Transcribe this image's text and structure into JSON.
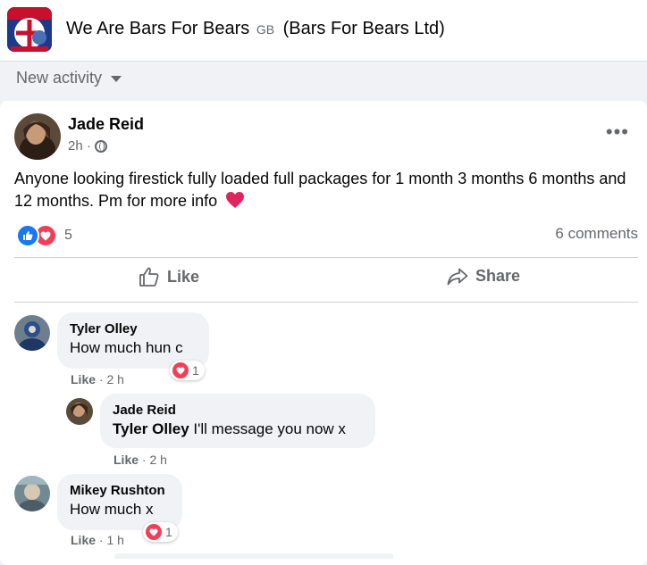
{
  "group": {
    "name": "We Are Bars For Bears",
    "country": "GB",
    "org": "(Bars For Bears Ltd)"
  },
  "sort": {
    "label": "New activity"
  },
  "post": {
    "author": "Jade Reid",
    "time": "2h ·",
    "text": "Anyone looking firestick fully loaded full packages for 1 month 3 months 6 months and 12 months. Pm for more info",
    "reaction_count": "5",
    "comments_count": "6 comments",
    "actions": {
      "like": "Like",
      "share": "Share"
    }
  },
  "comments": [
    {
      "name": "Tyler Olley",
      "text": "How much hun c",
      "like": "Like",
      "time": "· 2 h",
      "reactions": "1"
    },
    {
      "name": "Jade Reid",
      "mention": "Tyler Olley",
      "text": "I'll message you now x",
      "like": "Like",
      "time": "· 2 h"
    },
    {
      "name": "Mikey Rushton",
      "text": "How much x",
      "like": "Like",
      "time": "· 1 h",
      "reactions": "1"
    }
  ],
  "colors": {
    "like_blue": "#1877f2",
    "love_red": "#f33e58",
    "muted": "#65676b"
  }
}
